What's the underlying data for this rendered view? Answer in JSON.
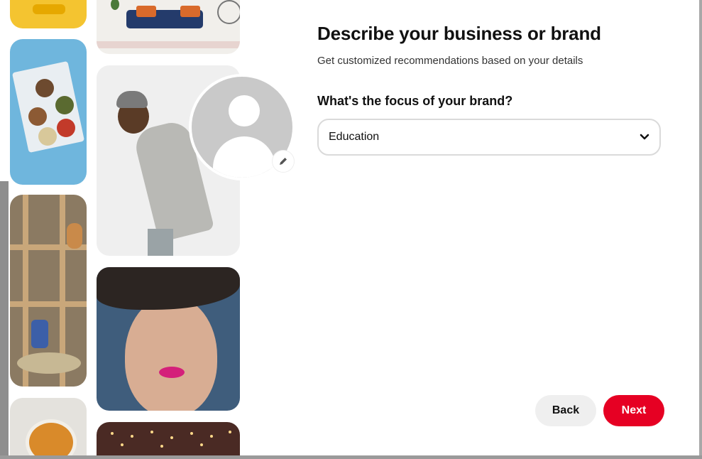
{
  "header": {
    "title": "Describe your business or brand",
    "subtitle": "Get customized recommendations based on your details"
  },
  "form": {
    "question": "What's the focus of your brand?",
    "focus_select": {
      "value": "Education"
    }
  },
  "footer": {
    "back_label": "Back",
    "next_label": "Next"
  },
  "icons": {
    "edit": "pencil-icon",
    "dropdown": "chevron-down-icon",
    "avatar": "default-profile-avatar"
  },
  "colors": {
    "accent": "#e60023",
    "secondary_button": "#efefef",
    "avatar_placeholder": "#c9c9c9"
  }
}
